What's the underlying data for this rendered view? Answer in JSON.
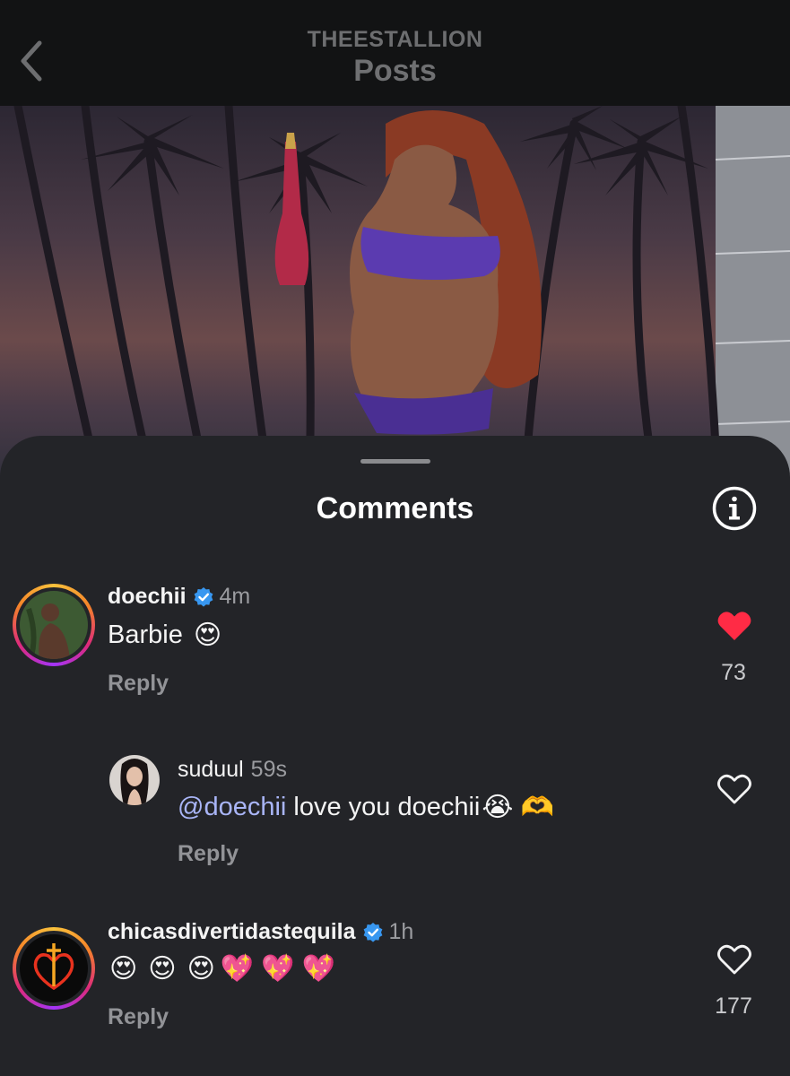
{
  "nav": {
    "account": "THEESTALLION",
    "title": "Posts",
    "back_icon": "chevron-left-icon"
  },
  "sheet": {
    "title": "Comments",
    "info_icon": "info-icon"
  },
  "comments": [
    {
      "username": "doechii",
      "verified": true,
      "time": "4m",
      "text": "Barbie",
      "emojis": [
        "😍"
      ],
      "reply_label": "Reply",
      "liked": true,
      "like_count": "73"
    },
    {
      "username": "suduul",
      "verified": false,
      "time": "59s",
      "mention": "@doechii",
      "text": " love you doechii",
      "emojis": [
        "😭",
        "🫶"
      ],
      "reply_label": "Reply",
      "liked": false,
      "like_count": ""
    },
    {
      "username": "chicasdivertidastequila",
      "verified": true,
      "time": "1h",
      "text": "",
      "emojis": [
        "😍",
        "😍",
        "😍",
        "💖",
        "💖",
        "💖"
      ],
      "reply_label": "Reply",
      "liked": false,
      "like_count": "177"
    }
  ],
  "colors": {
    "liked_heart": "#ff2b45",
    "mention": "#a9b5f7",
    "verified_badge": "#3897f0",
    "sheet_bg": "#232428"
  }
}
